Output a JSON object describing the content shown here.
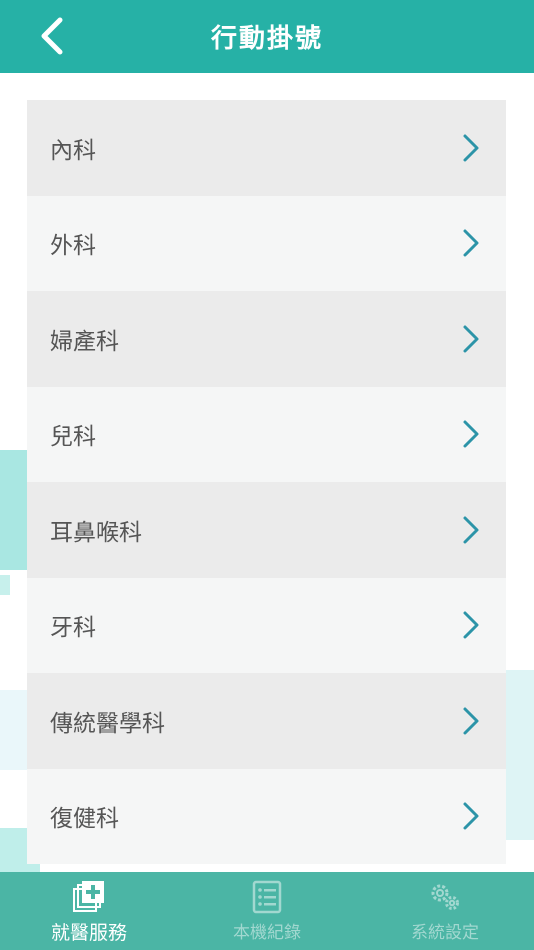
{
  "header": {
    "title": "行動掛號",
    "back_icon": "chevron-left-icon"
  },
  "departments": [
    {
      "label": "內科"
    },
    {
      "label": "外科"
    },
    {
      "label": "婦產科"
    },
    {
      "label": "兒科"
    },
    {
      "label": "耳鼻喉科"
    },
    {
      "label": "牙科"
    },
    {
      "label": "傳統醫學科"
    },
    {
      "label": "復健科"
    }
  ],
  "tabbar": {
    "tabs": [
      {
        "label": "就醫服務",
        "icon": "medical-cross-icon",
        "active": true
      },
      {
        "label": "本機紀錄",
        "icon": "record-list-icon",
        "active": false
      },
      {
        "label": "系統設定",
        "icon": "gears-icon",
        "active": false
      }
    ]
  },
  "colors": {
    "header_bg": "#26b1a6",
    "tabbar_bg": "#4bb5a5",
    "chevron": "#2c94a8",
    "row_odd": "#ebebeb",
    "row_even": "#f5f6f6"
  }
}
